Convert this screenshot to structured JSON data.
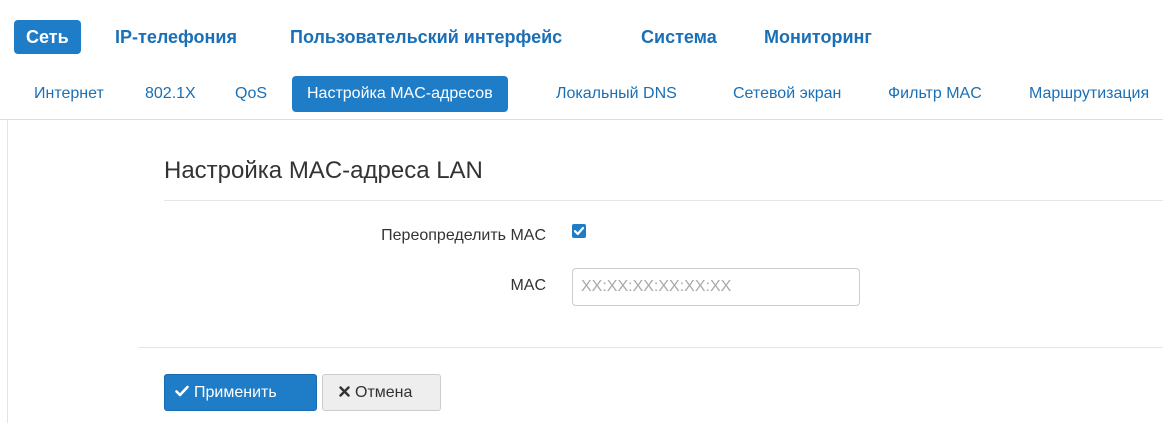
{
  "main_nav": [
    {
      "label": "Сеть",
      "active": true
    },
    {
      "label": "IP-телефония",
      "active": false
    },
    {
      "label": "Пользовательский интерфейс",
      "active": false
    },
    {
      "label": "Система",
      "active": false
    },
    {
      "label": "Мониторинг",
      "active": false
    }
  ],
  "sub_nav": [
    {
      "label": "Интернет",
      "active": false
    },
    {
      "label": "802.1X",
      "active": false
    },
    {
      "label": "QoS",
      "active": false
    },
    {
      "label": "Настройка MAC-адресов",
      "active": true
    },
    {
      "label": "Локальный DNS",
      "active": false
    },
    {
      "label": "Сетевой экран",
      "active": false
    },
    {
      "label": "Фильтр MAC",
      "active": false
    },
    {
      "label": "Маршрутизация",
      "active": false
    }
  ],
  "section": {
    "title": "Настройка MAC-адреса LAN"
  },
  "form": {
    "override_label": "Переопределить MAC",
    "override_checked": true,
    "mac_label": "MAC",
    "mac_value": "",
    "mac_placeholder": "XX:XX:XX:XX:XX:XX"
  },
  "actions": {
    "apply_label": "Применить",
    "cancel_label": "Отмена"
  },
  "colors": {
    "accent": "#1f7cc7",
    "link": "#1a6fb6"
  },
  "icons": {
    "apply": "check-icon",
    "cancel": "times-icon",
    "checkbox": "checkmark-icon"
  }
}
